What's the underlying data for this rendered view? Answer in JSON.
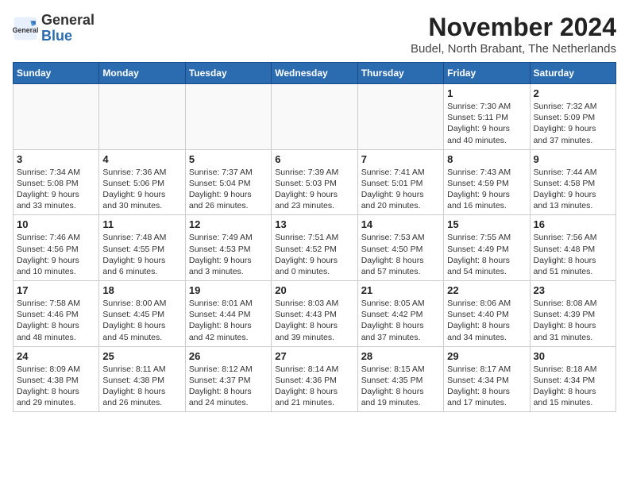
{
  "header": {
    "logo_line1": "General",
    "logo_line2": "Blue",
    "month_title": "November 2024",
    "location": "Budel, North Brabant, The Netherlands"
  },
  "days_of_week": [
    "Sunday",
    "Monday",
    "Tuesday",
    "Wednesday",
    "Thursday",
    "Friday",
    "Saturday"
  ],
  "weeks": [
    [
      {
        "day": "",
        "info": ""
      },
      {
        "day": "",
        "info": ""
      },
      {
        "day": "",
        "info": ""
      },
      {
        "day": "",
        "info": ""
      },
      {
        "day": "",
        "info": ""
      },
      {
        "day": "1",
        "info": "Sunrise: 7:30 AM\nSunset: 5:11 PM\nDaylight: 9 hours\nand 40 minutes."
      },
      {
        "day": "2",
        "info": "Sunrise: 7:32 AM\nSunset: 5:09 PM\nDaylight: 9 hours\nand 37 minutes."
      }
    ],
    [
      {
        "day": "3",
        "info": "Sunrise: 7:34 AM\nSunset: 5:08 PM\nDaylight: 9 hours\nand 33 minutes."
      },
      {
        "day": "4",
        "info": "Sunrise: 7:36 AM\nSunset: 5:06 PM\nDaylight: 9 hours\nand 30 minutes."
      },
      {
        "day": "5",
        "info": "Sunrise: 7:37 AM\nSunset: 5:04 PM\nDaylight: 9 hours\nand 26 minutes."
      },
      {
        "day": "6",
        "info": "Sunrise: 7:39 AM\nSunset: 5:03 PM\nDaylight: 9 hours\nand 23 minutes."
      },
      {
        "day": "7",
        "info": "Sunrise: 7:41 AM\nSunset: 5:01 PM\nDaylight: 9 hours\nand 20 minutes."
      },
      {
        "day": "8",
        "info": "Sunrise: 7:43 AM\nSunset: 4:59 PM\nDaylight: 9 hours\nand 16 minutes."
      },
      {
        "day": "9",
        "info": "Sunrise: 7:44 AM\nSunset: 4:58 PM\nDaylight: 9 hours\nand 13 minutes."
      }
    ],
    [
      {
        "day": "10",
        "info": "Sunrise: 7:46 AM\nSunset: 4:56 PM\nDaylight: 9 hours\nand 10 minutes."
      },
      {
        "day": "11",
        "info": "Sunrise: 7:48 AM\nSunset: 4:55 PM\nDaylight: 9 hours\nand 6 minutes."
      },
      {
        "day": "12",
        "info": "Sunrise: 7:49 AM\nSunset: 4:53 PM\nDaylight: 9 hours\nand 3 minutes."
      },
      {
        "day": "13",
        "info": "Sunrise: 7:51 AM\nSunset: 4:52 PM\nDaylight: 9 hours\nand 0 minutes."
      },
      {
        "day": "14",
        "info": "Sunrise: 7:53 AM\nSunset: 4:50 PM\nDaylight: 8 hours\nand 57 minutes."
      },
      {
        "day": "15",
        "info": "Sunrise: 7:55 AM\nSunset: 4:49 PM\nDaylight: 8 hours\nand 54 minutes."
      },
      {
        "day": "16",
        "info": "Sunrise: 7:56 AM\nSunset: 4:48 PM\nDaylight: 8 hours\nand 51 minutes."
      }
    ],
    [
      {
        "day": "17",
        "info": "Sunrise: 7:58 AM\nSunset: 4:46 PM\nDaylight: 8 hours\nand 48 minutes."
      },
      {
        "day": "18",
        "info": "Sunrise: 8:00 AM\nSunset: 4:45 PM\nDaylight: 8 hours\nand 45 minutes."
      },
      {
        "day": "19",
        "info": "Sunrise: 8:01 AM\nSunset: 4:44 PM\nDaylight: 8 hours\nand 42 minutes."
      },
      {
        "day": "20",
        "info": "Sunrise: 8:03 AM\nSunset: 4:43 PM\nDaylight: 8 hours\nand 39 minutes."
      },
      {
        "day": "21",
        "info": "Sunrise: 8:05 AM\nSunset: 4:42 PM\nDaylight: 8 hours\nand 37 minutes."
      },
      {
        "day": "22",
        "info": "Sunrise: 8:06 AM\nSunset: 4:40 PM\nDaylight: 8 hours\nand 34 minutes."
      },
      {
        "day": "23",
        "info": "Sunrise: 8:08 AM\nSunset: 4:39 PM\nDaylight: 8 hours\nand 31 minutes."
      }
    ],
    [
      {
        "day": "24",
        "info": "Sunrise: 8:09 AM\nSunset: 4:38 PM\nDaylight: 8 hours\nand 29 minutes."
      },
      {
        "day": "25",
        "info": "Sunrise: 8:11 AM\nSunset: 4:38 PM\nDaylight: 8 hours\nand 26 minutes."
      },
      {
        "day": "26",
        "info": "Sunrise: 8:12 AM\nSunset: 4:37 PM\nDaylight: 8 hours\nand 24 minutes."
      },
      {
        "day": "27",
        "info": "Sunrise: 8:14 AM\nSunset: 4:36 PM\nDaylight: 8 hours\nand 21 minutes."
      },
      {
        "day": "28",
        "info": "Sunrise: 8:15 AM\nSunset: 4:35 PM\nDaylight: 8 hours\nand 19 minutes."
      },
      {
        "day": "29",
        "info": "Sunrise: 8:17 AM\nSunset: 4:34 PM\nDaylight: 8 hours\nand 17 minutes."
      },
      {
        "day": "30",
        "info": "Sunrise: 8:18 AM\nSunset: 4:34 PM\nDaylight: 8 hours\nand 15 minutes."
      }
    ]
  ]
}
